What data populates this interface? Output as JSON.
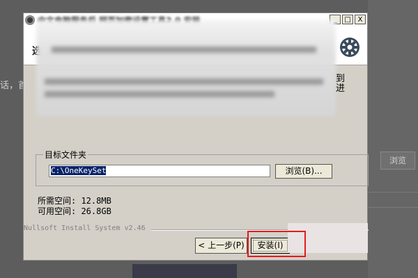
{
  "background": {
    "left_text": "话，首",
    "right_button": "浏览"
  },
  "dialog": {
    "title": "中文电脑服务后 网页加密设置工具2.0 安装",
    "window_buttons": [
      "_",
      "□",
      "X"
    ],
    "header_title": "选",
    "side_text_line1": "到",
    "side_text_line2": "进",
    "icon": "gear-icon"
  },
  "folder": {
    "group_label": "目标文件夹",
    "path_value": "C:\\OneKeySet",
    "browse_label": "浏览(B)..."
  },
  "space": {
    "required": "所需空间: 12.8MB",
    "available": "可用空间: 26.8GB"
  },
  "branding": "Nullsoft Install System v2.46",
  "buttons": {
    "back": "< 上一步(P)",
    "install": "安装(I)"
  },
  "colors": {
    "highlight": "#e31b1b",
    "selection": "#0a246a"
  }
}
